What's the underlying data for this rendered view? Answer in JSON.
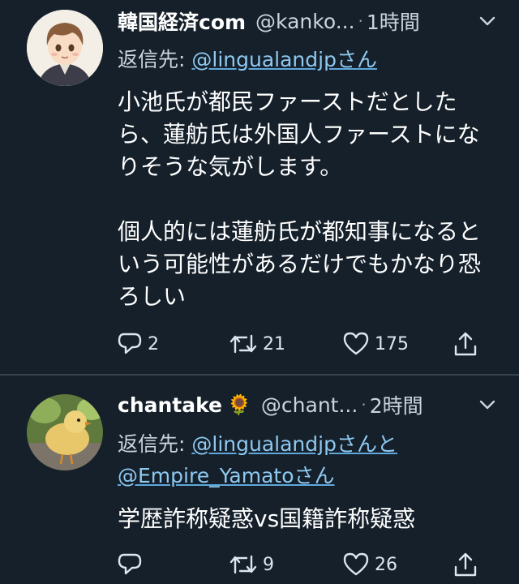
{
  "tweets": [
    {
      "name": "韓国経済com",
      "handle": "@kanko...",
      "separator": "·",
      "time": "1時間",
      "reply_prefix": "返信先: ",
      "reply_mention_1": "@lingualandjpさん",
      "text": "小池氏が都民ファーストだとしたら、蓮舫氏は外国人ファーストになりそうな気がします。\n\n個人的には蓮舫氏が都知事になるという可能性があるだけでもかなり恐ろしい",
      "counts": {
        "replies": "2",
        "retweets": "21",
        "likes": "175"
      }
    },
    {
      "name": "chantake",
      "emoji": "🌻",
      "handle": "@chant...",
      "separator": "·",
      "time": "2時間",
      "reply_prefix": "返信先: ",
      "reply_mention_1": "@lingualandjpさんと",
      "reply_mention_2": "@Empire_Yamatoさん",
      "text": "学歴詐称疑惑vs国籍詐称疑惑",
      "counts": {
        "replies": "",
        "retweets": "9",
        "likes": "26"
      }
    }
  ],
  "icons": {
    "more": "chevron-down-icon",
    "reply": "reply-bubble-icon",
    "retweet": "retweet-icon",
    "like": "heart-icon",
    "share": "share-icon"
  },
  "colors": {
    "background": "#15202b",
    "divider": "#38444d",
    "mention": "#8ec9f0",
    "secondary_text": "#c9d4dd"
  }
}
